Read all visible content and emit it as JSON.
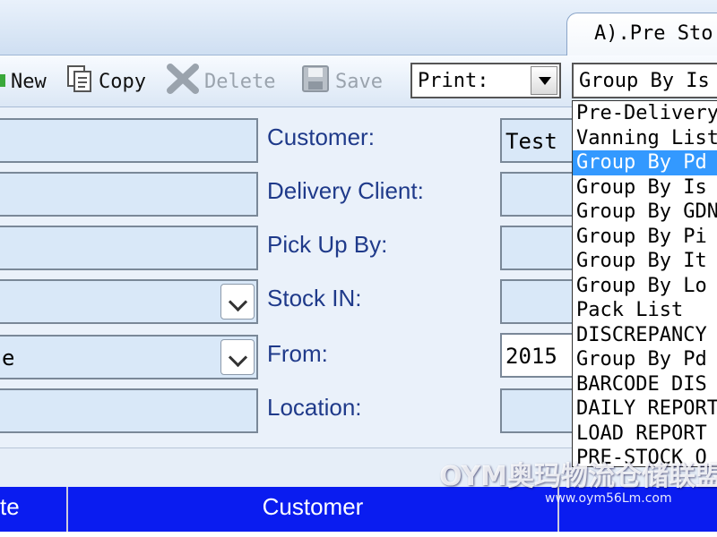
{
  "tab": {
    "title": "A).Pre Sto"
  },
  "toolbar": {
    "new_label": "New",
    "copy_label": "Copy",
    "delete_label": "Delete",
    "save_label": "Save",
    "print_label": "Print:",
    "group_selected": "Group By Is"
  },
  "form": {
    "labels": {
      "customer": "Customer:",
      "delivery_client": "Delivery Client:",
      "pick_up_by": "Pick Up By:",
      "stock_in": "Stock IN:",
      "from": "From:",
      "location": "Location:"
    },
    "values": {
      "left_combo_2": "e",
      "customer": "Test",
      "from": "2015"
    }
  },
  "dropdown": {
    "items": [
      "Pre-Delivery",
      "Vanning List",
      "Group By Pd",
      "Group By Is",
      "Group By GDN",
      "Group By Pi",
      "Group By It",
      "Group By Lo",
      "Pack List",
      "DISCREPANCY",
      "Group By Pd",
      "BARCODE DIS",
      "DAILY REPORT",
      "LOAD REPORT",
      "PRE-STOCK O"
    ],
    "selected_index": 2
  },
  "grid": {
    "headers": [
      "te",
      "Customer",
      ""
    ]
  },
  "watermark": {
    "logo": "OYM奥玛物流仓储联盟",
    "url": "www.oym56Lm.com"
  },
  "colors": {
    "grid_header": "#0a1cf0",
    "label_text": "#1f3a8a",
    "selection": "#3399ff"
  }
}
